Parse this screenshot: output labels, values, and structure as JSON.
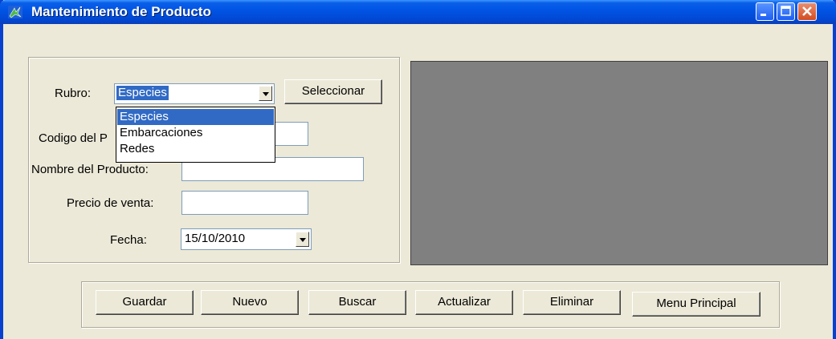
{
  "window": {
    "title": "Mantenimiento de Producto",
    "icon": "app-leaf-icon"
  },
  "form": {
    "rubro_label": "Rubro:",
    "rubro_value": "Especies",
    "rubro_options": [
      "Especies",
      "Embarcaciones",
      "Redes"
    ],
    "seleccionar_label": "Seleccionar",
    "codigo_label": "Codigo del Producto:",
    "codigo_visible_label": "Codigo del P",
    "codigo_value": "",
    "nombre_label": "Nombre del Producto:",
    "nombre_value": "",
    "precio_label": "Precio de venta:",
    "precio_value": "",
    "fecha_label": "Fecha:",
    "fecha_value": "15/10/2010"
  },
  "buttons": {
    "guardar": "Guardar",
    "nuevo": "Nuevo",
    "buscar": "Buscar",
    "actualizar": "Actualizar",
    "eliminar": "Eliminar",
    "menu_principal": "Menu Principal"
  },
  "colors": {
    "titlebar": "#0155e5",
    "selection": "#316ac5",
    "preview_panel": "#808080",
    "window_bg": "#ece9d8"
  }
}
